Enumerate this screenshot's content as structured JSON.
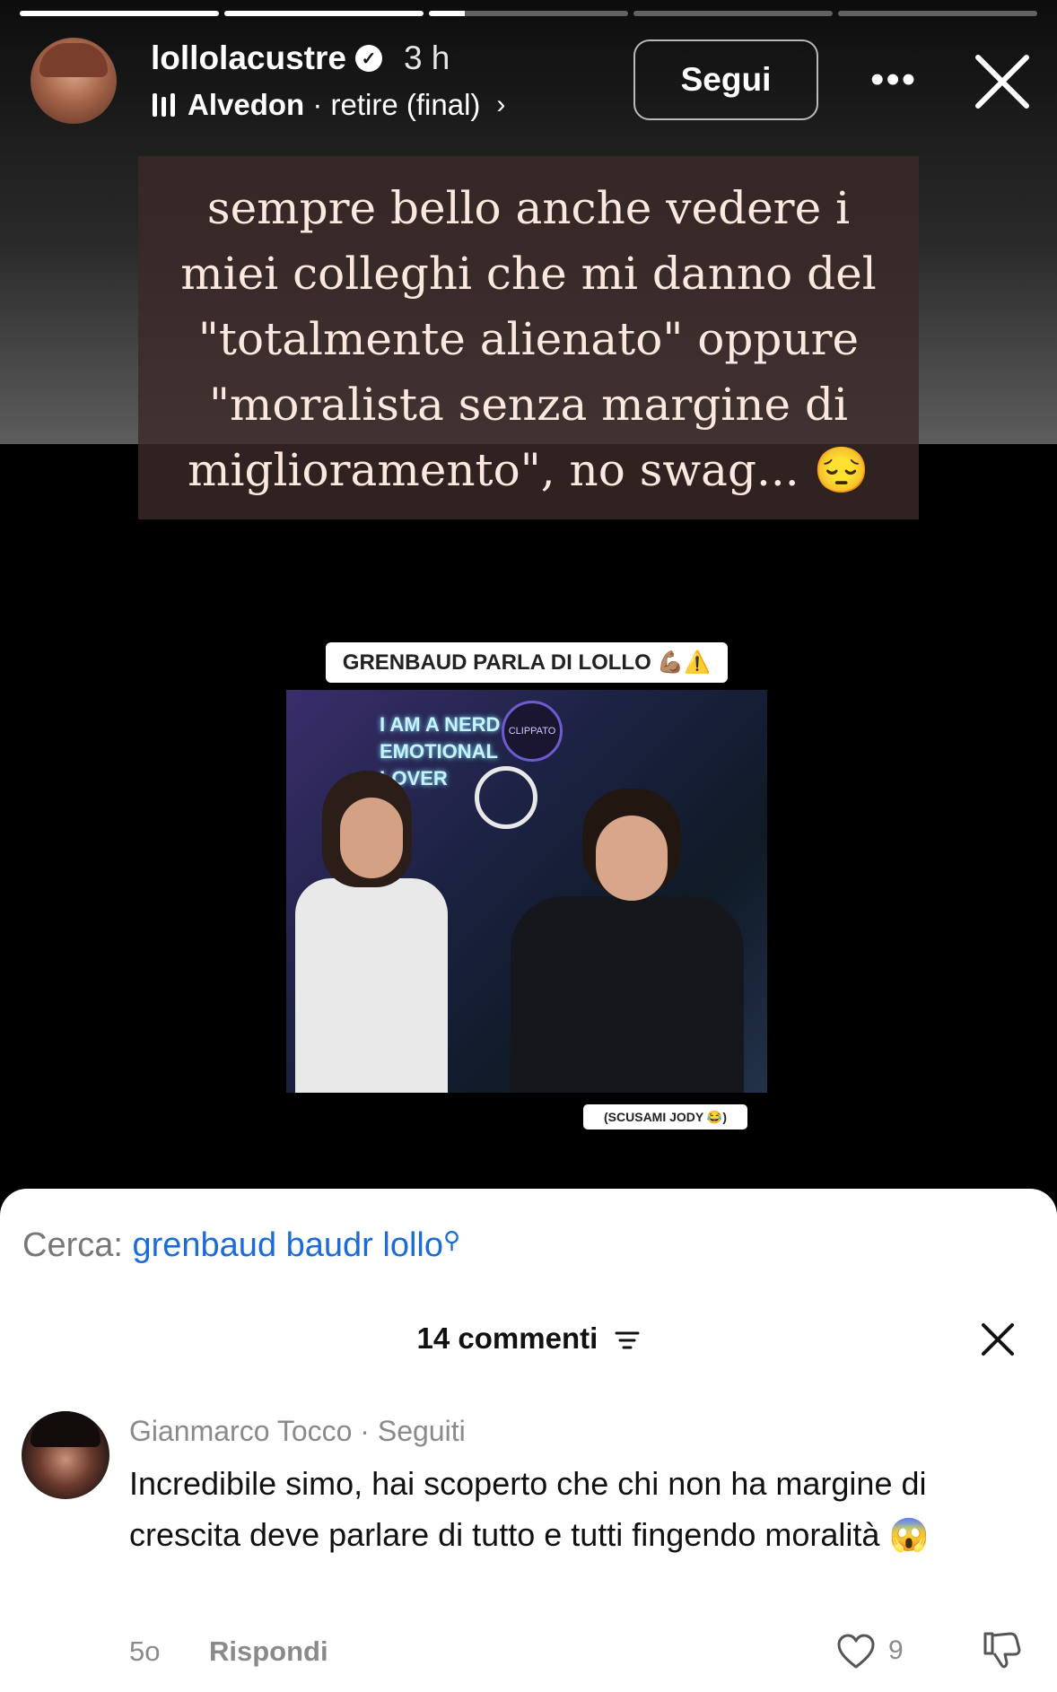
{
  "story": {
    "progress_segments": [
      1,
      1,
      0.18,
      0,
      0
    ],
    "username": "lollolacustre",
    "time": "3 h",
    "music_artist": "Alvedon",
    "music_sep": " · ",
    "music_title": "retire (final)",
    "follow_label": "Segui",
    "more_icon": "ellipsis-icon",
    "close_icon": "close-icon",
    "caption_lines": [
      "sempre bello anche vedere i",
      "miei colleghi che mi danno del",
      "\"totalmente alienato\" oppure",
      "\"moralista senza margine di",
      "miglioramento\", no swag... 😔"
    ],
    "video_label_top": "GRENBAUD PARLA DI LOLLO 💪🏽⚠️",
    "video_neon_lines": [
      "I AM A NERD",
      "EMOTIONAL",
      "LOVER"
    ],
    "video_logo_text": "CLIPPATO",
    "video_label_bottom": "(SCUSAMI JODY 😂)"
  },
  "sheet": {
    "search_prefix": "Cerca: ",
    "search_query": "grenbaud baudr lollo",
    "comments_title": "14 commenti",
    "filter_icon": "filter-icon",
    "close_icon": "close-icon",
    "comment": {
      "author": "Gianmarco Tocco",
      "relation": " · Seguiti",
      "text": "Incredibile simo, hai scoperto che chi non ha margine di crescita deve parlare di tutto e tutti fingendo moralità 😱",
      "age": "5o",
      "reply_label": "Rispondi",
      "likes": "9"
    }
  },
  "colors": {
    "link_blue": "#1c6bd8",
    "caption_bg": "#3a2a28",
    "caption_text": "#fbe9df"
  }
}
